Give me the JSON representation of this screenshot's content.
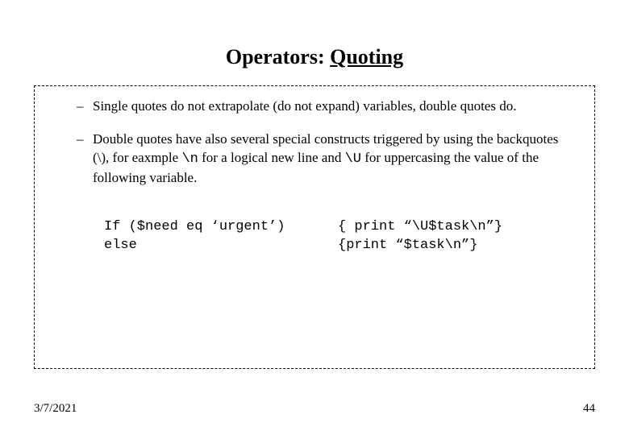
{
  "title": {
    "main": "Operators: ",
    "underlined": "Quoting"
  },
  "bullets": [
    {
      "dash": "–",
      "text": "Single quotes do not extrapolate (do not expand) variables, double quotes do."
    },
    {
      "dash": "–",
      "text_parts": {
        "p1": "Double quotes have also several special constructs triggered by using the backquotes (\\), for eaxmple ",
        "code1": "\\n",
        "p2": " for a logical new line and ",
        "code2": "\\U",
        "p3": " for uppercasing the value of the following variable."
      }
    }
  ],
  "code": {
    "left": {
      "line1": "If ($need eq ‘urgent’)",
      "line2": "else"
    },
    "right": {
      "line1": "{ print “\\U$task\\n”}",
      "line2": "{print “$task\\n”}"
    }
  },
  "footer": {
    "date": "3/7/2021",
    "page": "44"
  }
}
